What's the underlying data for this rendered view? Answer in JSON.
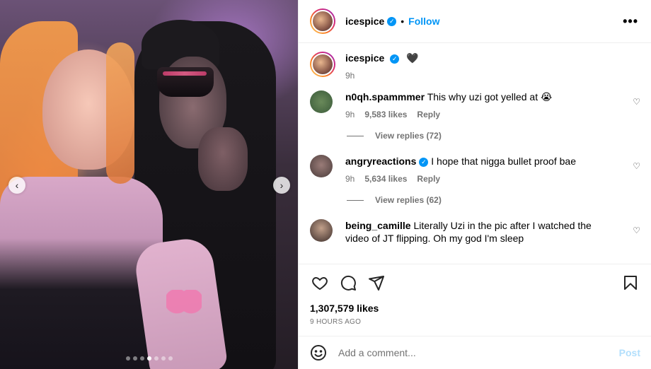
{
  "post": {
    "username": "icespice",
    "follow_label": "Follow",
    "separator": "•",
    "more_label": "•••",
    "carousel": {
      "total": 7,
      "active": 4
    },
    "prev_label": "‹",
    "next_label": "›"
  },
  "caption": {
    "username": "icespice",
    "text": "🖤",
    "time": "9h"
  },
  "comments": [
    {
      "username": "n0qh.spammmer",
      "verified": false,
      "text": "This why uzi got yelled at 😭",
      "time": "9h",
      "likes": "9,583 likes",
      "reply_label": "Reply",
      "view_replies": "View replies (72)"
    },
    {
      "username": "angryreactions",
      "verified": true,
      "text": "I hope that nigga bullet proof bae",
      "time": "9h",
      "likes": "5,634 likes",
      "reply_label": "Reply",
      "view_replies": "View replies (62)"
    },
    {
      "username": "being_camille",
      "verified": false,
      "text": "Literally Uzi in the pic after I watched the video of JT flipping. Oh my god I'm sleep"
    }
  ],
  "actions": {
    "like_icon": "heart-icon",
    "comment_icon": "comment-icon",
    "share_icon": "share-icon",
    "save_icon": "bookmark-icon"
  },
  "likes_count": "1,307,579 likes",
  "posted_ago": "9 HOURS AGO",
  "add_comment": {
    "placeholder": "Add a comment...",
    "post_label": "Post"
  },
  "colors": {
    "accent": "#0095f6",
    "muted": "#737373",
    "post_disabled": "#b2dffc"
  }
}
